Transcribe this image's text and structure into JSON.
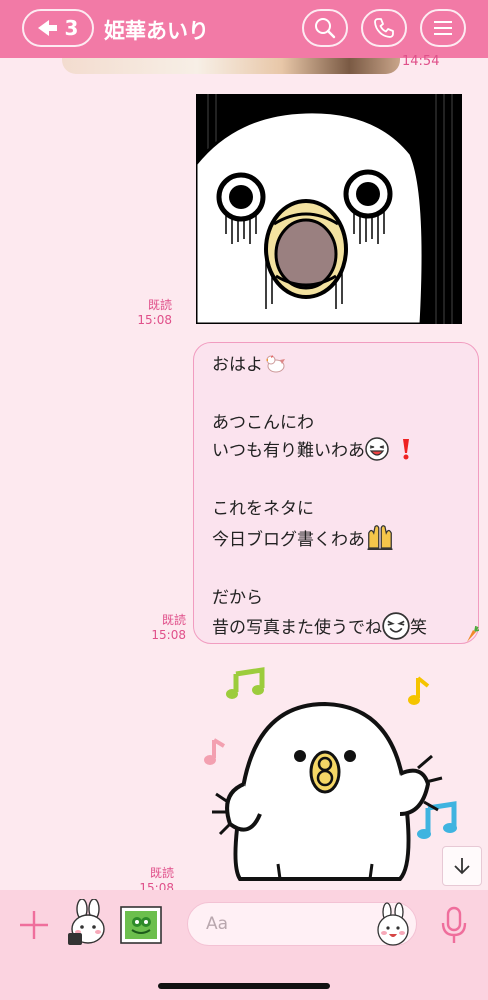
{
  "header": {
    "back_count": "3",
    "title": "姫華あいり",
    "icons": [
      "back-arrow-icon",
      "search-icon",
      "phone-icon",
      "menu-icon"
    ],
    "color": "#f27aa6"
  },
  "messages": {
    "prev_timestamp": "14:54",
    "sticker1_meta": {
      "read": "既読",
      "time": "15:08"
    },
    "text_meta": {
      "read": "既読",
      "time": "15:08"
    },
    "sticker2_meta": {
      "read": "既読",
      "time": "15:08"
    },
    "text_lines": {
      "l1": "おはよ",
      "l2": "あつこんにわ",
      "l3": "いつも有り難いわあ",
      "l4": "これをネタに",
      "l5": "今日ブログ書くわあ",
      "l6": "だから",
      "l7": "昔の写真また使うでね",
      "l7_suffix": "笑"
    },
    "emojis": [
      "chicken-emoji",
      "laughing-face-emoji",
      "exclamation-emoji",
      "raised-hands-emoji",
      "grinning-face-emoji",
      "carrot-icon"
    ]
  },
  "input": {
    "placeholder": "Aa",
    "icons": [
      "plus-icon",
      "sticker-icon",
      "photo-icon",
      "emoji-icon",
      "mic-icon"
    ]
  },
  "theme": {
    "background": "#fde9ef",
    "accent": "#e0508a",
    "bubble": "#fbe3ee",
    "input_bar": "#fbd3e0"
  }
}
